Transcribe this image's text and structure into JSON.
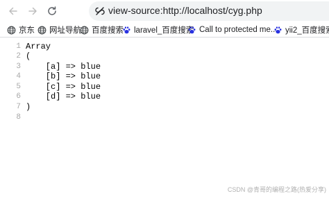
{
  "browser": {
    "url": "view-source:http://localhost/cyg.php",
    "icons": {
      "back": "back-arrow-icon",
      "forward": "forward-arrow-icon",
      "reload": "reload-icon",
      "site": "site-info-icon"
    }
  },
  "bookmarks": [
    {
      "label": "京东",
      "icon": "globe-icon"
    },
    {
      "label": "网址导航",
      "icon": "globe-icon"
    },
    {
      "label": "百度搜索",
      "icon": "globe-icon"
    },
    {
      "label": "laravel_百度搜索",
      "icon": "baidu-paw-icon"
    },
    {
      "label": "Call to protected me...",
      "icon": "baidu-paw-icon"
    },
    {
      "label": "yii2_百度搜索",
      "icon": "baidu-paw-icon"
    }
  ],
  "source_lines": [
    {
      "num": "1",
      "text": "Array"
    },
    {
      "num": "2",
      "text": "("
    },
    {
      "num": "3",
      "text": "    [a] => blue"
    },
    {
      "num": "4",
      "text": "    [b] => blue"
    },
    {
      "num": "5",
      "text": "    [c] => blue"
    },
    {
      "num": "6",
      "text": "    [d] => blue"
    },
    {
      "num": "7",
      "text": ")"
    },
    {
      "num": "8",
      "text": ""
    }
  ],
  "watermark": "CSDN @青哥的编程之路(热爱分享)",
  "colors": {
    "omnibox_bg": "#f1f3f4",
    "line_number": "#a8a8a8",
    "baidu_blue": "#2932e1"
  }
}
